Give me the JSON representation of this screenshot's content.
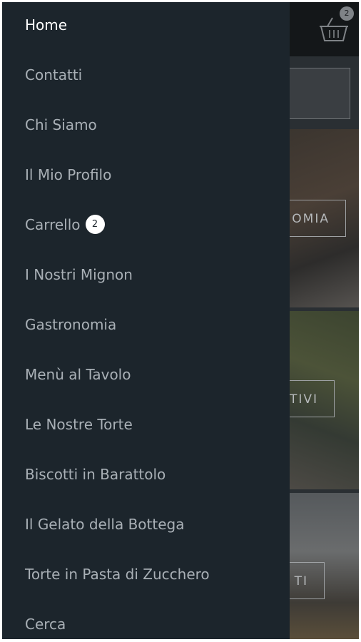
{
  "drawer": {
    "items": [
      {
        "label": "Home",
        "active": true
      },
      {
        "label": "Contatti"
      },
      {
        "label": "Chi Siamo"
      },
      {
        "label": "Il Mio Profilo"
      },
      {
        "label": "Carrello",
        "badge": "2"
      },
      {
        "label": "I Nostri Mignon"
      },
      {
        "label": "Gastronomia"
      },
      {
        "label": "Menù al Tavolo"
      },
      {
        "label": "Le Nostre Torte"
      },
      {
        "label": "Biscotti in Barattolo"
      },
      {
        "label": "Il Gelato della Bottega"
      },
      {
        "label": "Torte in Pasta di Zucchero"
      },
      {
        "label": "Cerca"
      }
    ]
  },
  "background_page": {
    "cart_icon": "basket-icon",
    "cart_badge": "2",
    "tiles": [
      {
        "label": "OMIA"
      },
      {
        "label": "TIVI"
      },
      {
        "label": "TI"
      }
    ]
  },
  "colors": {
    "drawer_bg": "#1c252c",
    "active_text": "#ffffff",
    "inactive_text": "#a9b0b6",
    "badge_bg": "#ffffff"
  }
}
